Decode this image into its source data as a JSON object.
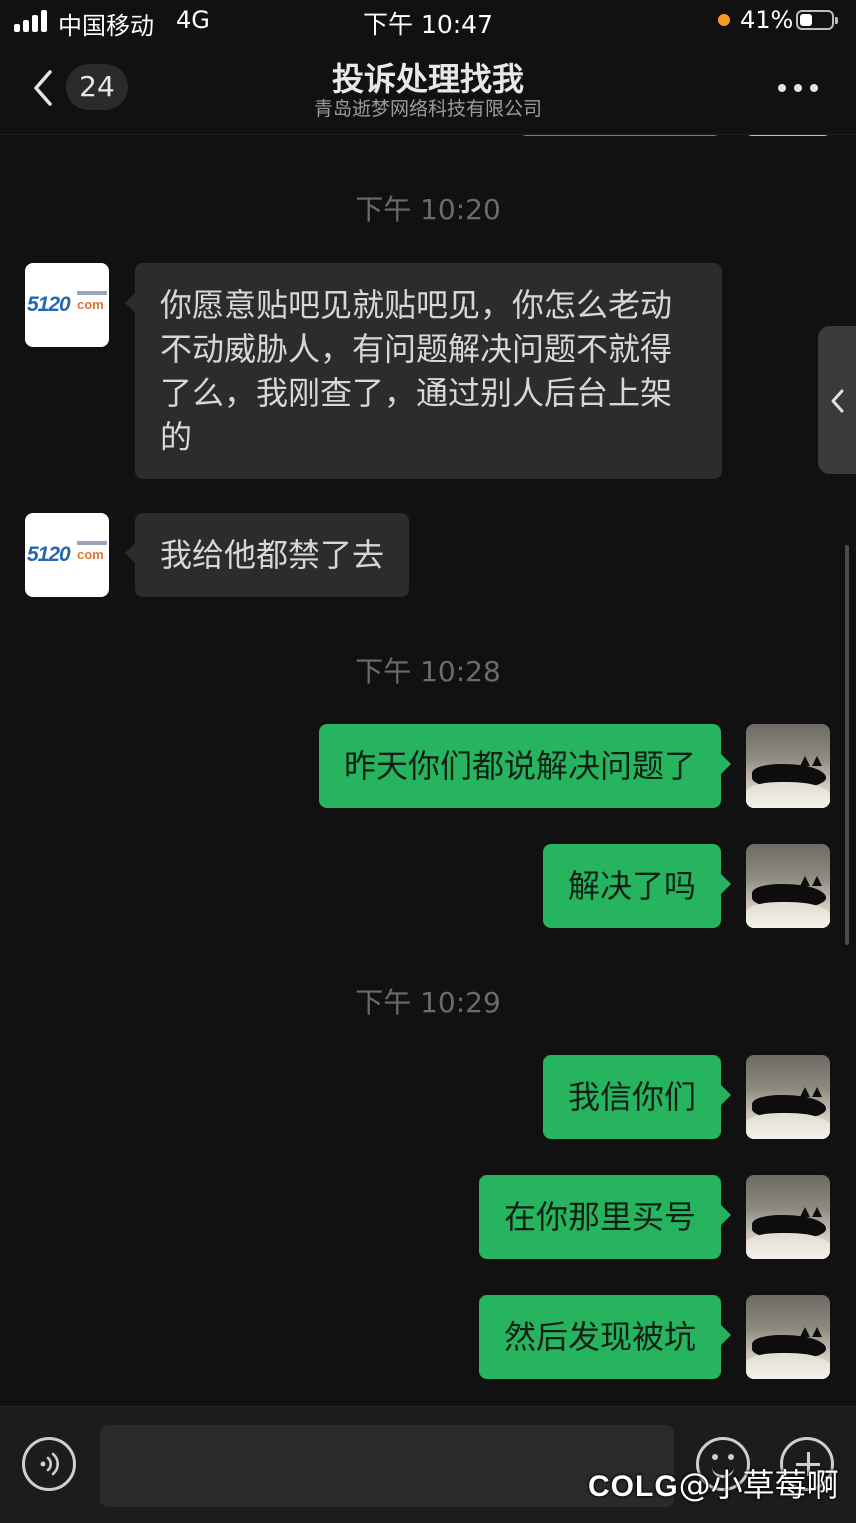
{
  "status_bar": {
    "carrier": "中国移动",
    "network": "4G",
    "time": "下午 10:47",
    "battery_percent_text": "41%",
    "battery_level": 0.41,
    "signal_bars": 4
  },
  "header": {
    "back_icon": "chevron-left-icon",
    "unread_count": "24",
    "title": "投诉处理找我",
    "subtitle": "青岛逝梦网络科技有限公司",
    "more_icon": "more-icon"
  },
  "chat": {
    "time_1": "下午 10:20",
    "msg_1": "你愿意贴吧见就贴吧见，你怎么老动不动威胁人，有问题解决问题不就得了么，我刚查了，通过别人后台上架的",
    "msg_2": "我给他都禁了去",
    "time_2": "下午 10:28",
    "msg_3": "昨天你们都说解决问题了",
    "msg_4": "解决了吗",
    "time_3": "下午 10:29",
    "msg_5": "我信你们",
    "msg_6": "在你那里买号",
    "msg_7": "然后发现被坑",
    "contact_logo": "5120",
    "contact_logo_suffix": "com"
  },
  "input_bar": {
    "voice_icon": "voice-icon",
    "text_value": "",
    "emoji_icon": "emoji-icon",
    "plus_icon": "plus-icon"
  },
  "watermark": {
    "brand": "COLG",
    "user": "@小草莓啊"
  },
  "colors": {
    "background": "#111111",
    "outgoing_bubble": "#26b45e",
    "incoming_bubble": "#2c2c2c",
    "battery_dot": "#f29b26"
  }
}
